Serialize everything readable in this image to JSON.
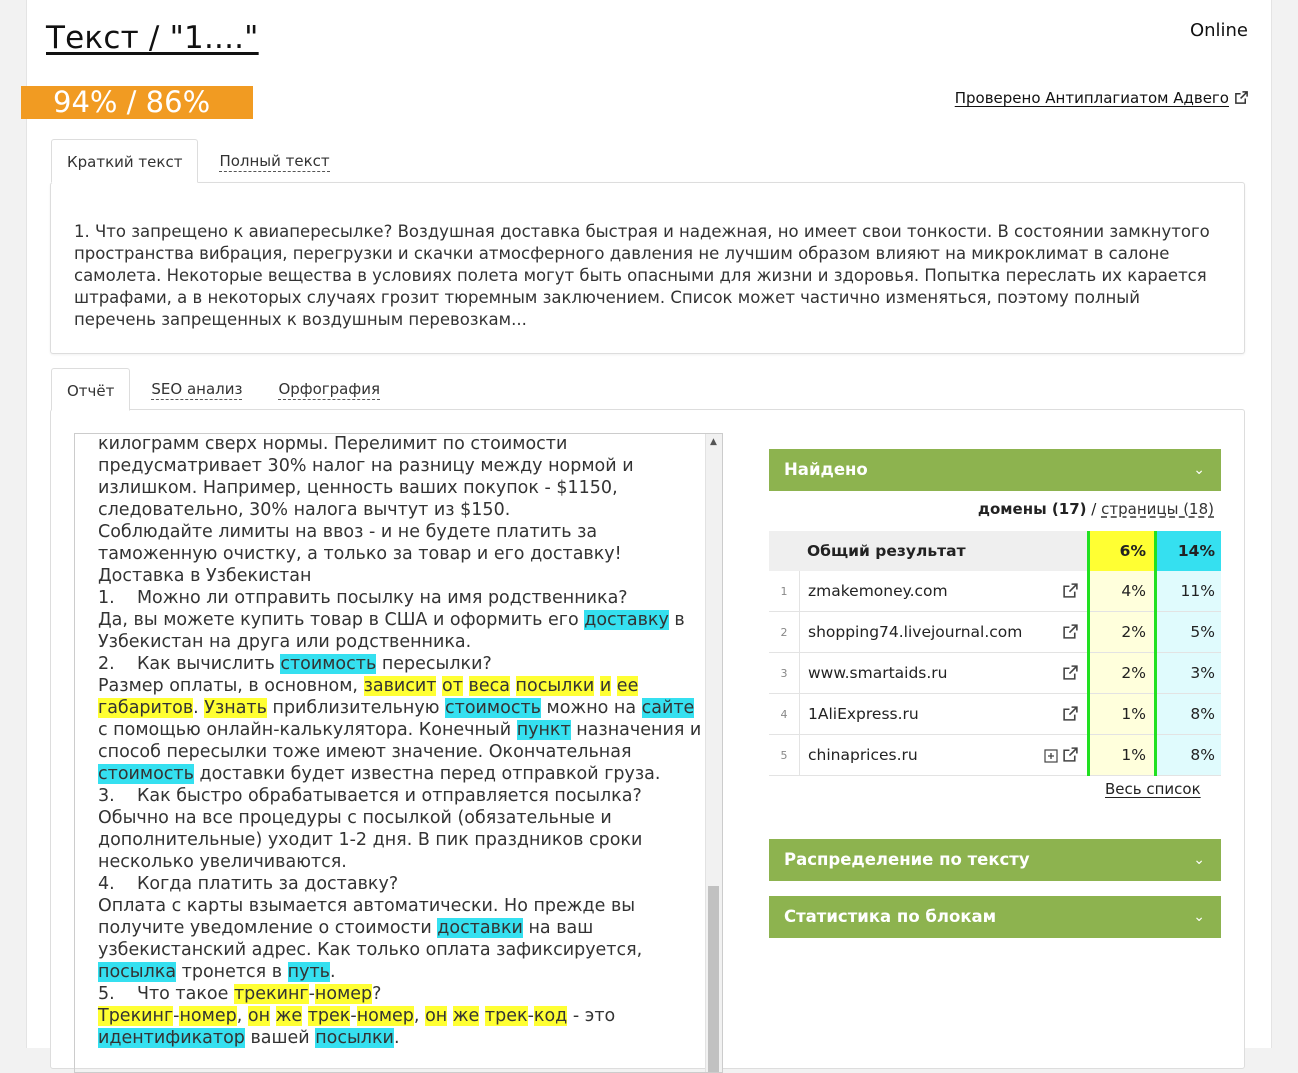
{
  "header": {
    "title": "Текст / \"1....\"",
    "status": "Online",
    "score": "94% / 86%",
    "checked_link": "Проверено Антиплагиатом Адвего"
  },
  "text_tabs": [
    {
      "label": "Краткий текст",
      "active": true
    },
    {
      "label": "Полный текст",
      "active": false
    }
  ],
  "summary_text": "1. Что запрещено к авиапересылке? Воздушная доставка быстрая и надежная, но имеет свои тонкости. В состоянии замкнутого пространства вибрация, перегрузки и скачки атмосферного давления не лучшим образом влияют на микроклимат в салоне самолета. Некоторые вещества в условиях полета могут быть опасными для жизни и здоровья. Попытка переслать их карается штрафами, а в некоторых случаях грозит тюремным заключением. Список может частично изменяться, поэтому полный перечень запрещенных к воздушным перевозкам...",
  "report_tabs": [
    {
      "label": "Отчёт",
      "active": true
    },
    {
      "label": "SEO анализ",
      "active": false
    },
    {
      "label": "Орфография",
      "active": false
    }
  ],
  "report_text": [
    [
      [
        "килограмм сверх нормы. Перелимит по стоимости",
        ""
      ]
    ],
    [
      [
        "предусматривает 30% налог на разницу между нормой и",
        ""
      ]
    ],
    [
      [
        "излишком. Например, ценность ваших покупок - $1150,",
        ""
      ]
    ],
    [
      [
        "следовательно, 30% налога вычтут из $150.",
        ""
      ]
    ],
    [
      [
        "Соблюдайте лимиты на ввоз - и не будете платить за",
        ""
      ]
    ],
    [
      [
        "таможенную очистку, а только за товар и его доставку!",
        ""
      ]
    ],
    [
      [
        "Доставка в Узбекистан",
        ""
      ]
    ],
    [
      [
        "1.    Можно ли отправить посылку на имя родственника?",
        ""
      ]
    ],
    [
      [
        "Да, вы можете купить товар в США и оформить его ",
        ""
      ],
      [
        "доставку",
        "c"
      ],
      [
        " в",
        ""
      ]
    ],
    [
      [
        "Узбекистан на друга или родственника.",
        ""
      ]
    ],
    [
      [
        "2.    Как вычислить ",
        ""
      ],
      [
        "стоимость",
        "c"
      ],
      [
        " пересылки?",
        ""
      ]
    ],
    [
      [
        "Размер оплаты, в основном, ",
        ""
      ],
      [
        "зависит",
        "y"
      ],
      [
        " ",
        ""
      ],
      [
        "от",
        "y"
      ],
      [
        " ",
        ""
      ],
      [
        "веса",
        "y"
      ],
      [
        " ",
        ""
      ],
      [
        "посылки",
        "y"
      ],
      [
        " ",
        ""
      ],
      [
        "и",
        "y"
      ],
      [
        " ",
        ""
      ],
      [
        "ее",
        "y"
      ]
    ],
    [
      [
        "габаритов",
        "y"
      ],
      [
        ". ",
        ""
      ],
      [
        "Узнать",
        "y"
      ],
      [
        " приблизительную ",
        ""
      ],
      [
        "стоимость",
        "c"
      ],
      [
        " можно на ",
        ""
      ],
      [
        "сайте",
        "c"
      ]
    ],
    [
      [
        "с помощью онлайн-калькулятора. Конечный ",
        ""
      ],
      [
        "пункт",
        "c"
      ],
      [
        " назначения и",
        ""
      ]
    ],
    [
      [
        "способ пересылки тоже имеют значение. Окончательная",
        ""
      ]
    ],
    [
      [
        "стоимость",
        "c"
      ],
      [
        " доставки будет известна перед отправкой груза.",
        ""
      ]
    ],
    [
      [
        "3.    Как быстро обрабатывается и отправляется посылка?",
        ""
      ]
    ],
    [
      [
        "Обычно на все процедуры с посылкой (обязательные и",
        ""
      ]
    ],
    [
      [
        "дополнительные) уходит 1-2 дня. В пик праздников сроки",
        ""
      ]
    ],
    [
      [
        "несколько увеличиваются.",
        ""
      ]
    ],
    [
      [
        "4.    Когда платить за доставку?",
        ""
      ]
    ],
    [
      [
        "Оплата с карты взымается автоматически. Но прежде вы",
        ""
      ]
    ],
    [
      [
        "получите уведомление о стоимости ",
        ""
      ],
      [
        "доставки",
        "c"
      ],
      [
        " на ваш",
        ""
      ]
    ],
    [
      [
        "узбекистанский адрес. Как только оплата зафиксируется,",
        ""
      ]
    ],
    [
      [
        "посылка",
        "c"
      ],
      [
        " тронется в ",
        ""
      ],
      [
        "путь",
        "c"
      ],
      [
        ".",
        ""
      ]
    ],
    [
      [
        "5.    Что такое ",
        ""
      ],
      [
        "трекинг",
        "y"
      ],
      [
        "-",
        ""
      ],
      [
        "номер",
        "y"
      ],
      [
        "?",
        ""
      ]
    ],
    [
      [
        "Трекинг",
        "y"
      ],
      [
        "-",
        ""
      ],
      [
        "номер",
        "y"
      ],
      [
        ", ",
        ""
      ],
      [
        "он",
        "y"
      ],
      [
        " ",
        ""
      ],
      [
        "же",
        "y"
      ],
      [
        " ",
        ""
      ],
      [
        "трек",
        "y"
      ],
      [
        "-",
        ""
      ],
      [
        "номер",
        "y"
      ],
      [
        ", ",
        ""
      ],
      [
        "он",
        "y"
      ],
      [
        " ",
        ""
      ],
      [
        "же",
        "y"
      ],
      [
        " ",
        ""
      ],
      [
        "трек",
        "y"
      ],
      [
        "-",
        ""
      ],
      [
        "код",
        "y"
      ],
      [
        " - это",
        ""
      ]
    ],
    [
      [
        "идентификатор",
        "c"
      ],
      [
        " вашей ",
        ""
      ],
      [
        "посылки",
        "c"
      ],
      [
        ".",
        ""
      ]
    ]
  ],
  "found_panel": {
    "title": "Найдено",
    "domains_label": "домены",
    "domains_count": "(17)",
    "separator": "/",
    "pages_label": "страницы (18)",
    "total": {
      "label": "Общий результат",
      "p1": "6%",
      "p2": "14%"
    },
    "rows": [
      {
        "n": "1",
        "domain": "zmakemoney.com",
        "p1": "4%",
        "p2": "11%",
        "plus": false
      },
      {
        "n": "2",
        "domain": "shopping74.livejournal.com",
        "p1": "2%",
        "p2": "5%",
        "plus": false
      },
      {
        "n": "3",
        "domain": "www.smartaids.ru",
        "p1": "2%",
        "p2": "3%",
        "plus": false
      },
      {
        "n": "4",
        "domain": "1AliExpress.ru",
        "p1": "1%",
        "p2": "8%",
        "plus": false
      },
      {
        "n": "5",
        "domain": "chinaprices.ru",
        "p1": "1%",
        "p2": "8%",
        "plus": true
      }
    ],
    "full_list": "Весь список"
  },
  "distribution_panel": {
    "title": "Распределение по тексту"
  },
  "blocks_panel": {
    "title": "Статистика по блокам"
  },
  "colors": {
    "score_badge": "#f19b22",
    "panel_green": "#8db34f",
    "highlight_yellow": "#ffff33",
    "highlight_cyan": "#35e0f0",
    "column_divider": "#21e021"
  },
  "icons": {
    "external_link": "external-link-icon",
    "expand": "plus-box-icon",
    "chevron": "chevron-down-icon"
  }
}
